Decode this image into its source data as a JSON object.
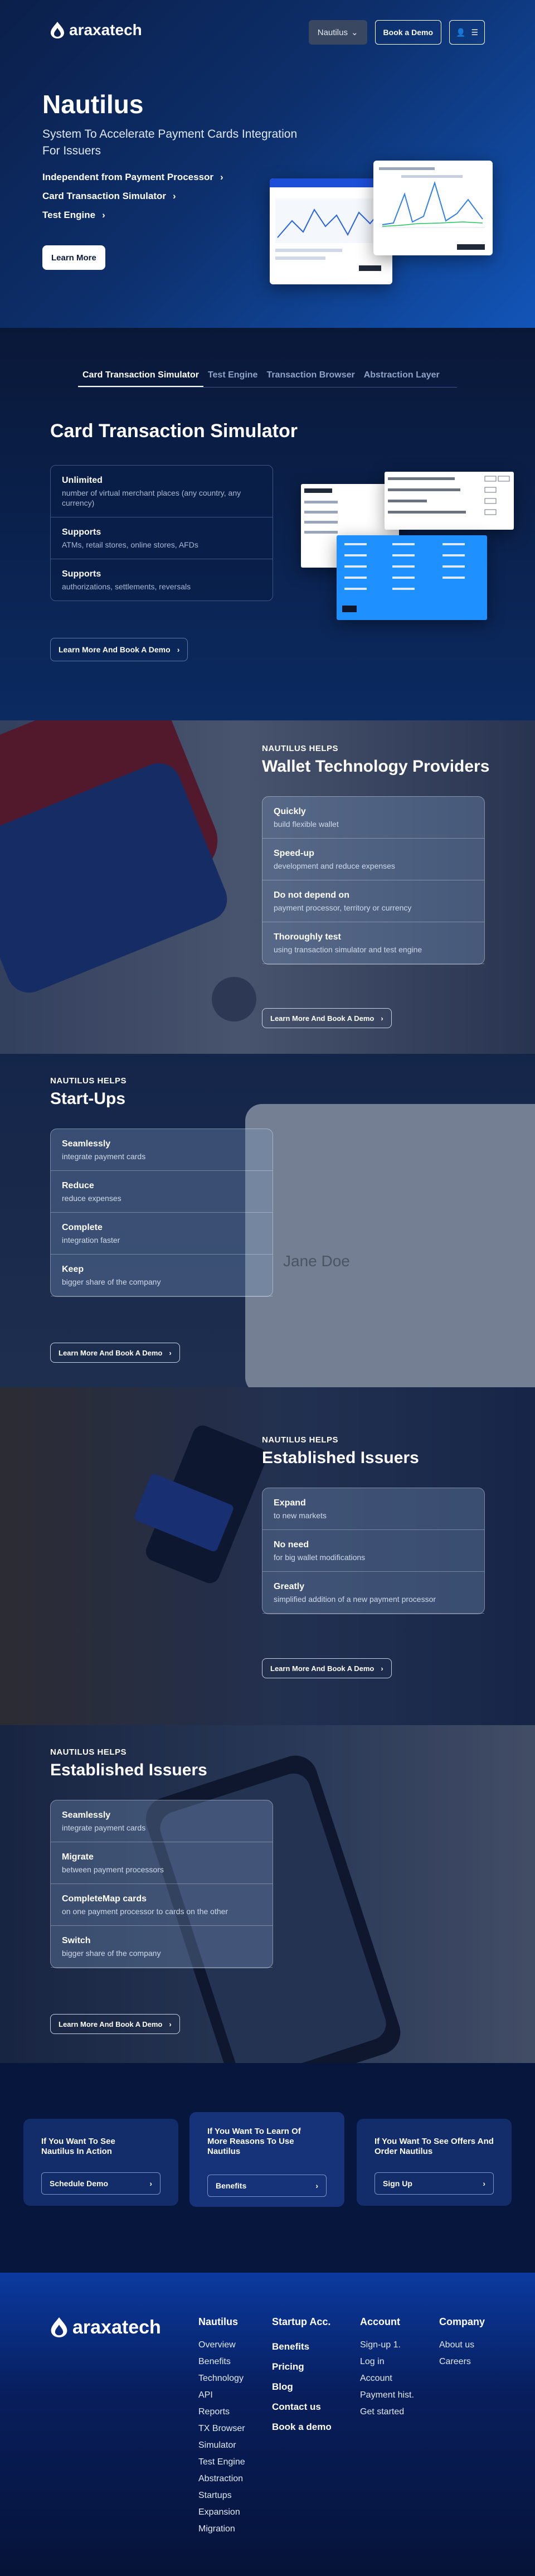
{
  "brand": {
    "name": "araxatech",
    "logo_icon": "flame-logo-icon"
  },
  "header": {
    "product_select": "Nautilus",
    "demo_button": "Book a Demo",
    "user_icon": "user-icon",
    "menu_icon": "menu-icon"
  },
  "hero": {
    "title": "Nautilus",
    "subtitle": "System To Accelerate Payment Cards Integration For Issuers",
    "links": [
      "Independent from Payment Processor",
      "Card Transaction Simulator",
      "Test Engine"
    ],
    "cta": "Learn More"
  },
  "tabs": [
    "Card Transaction Simulator",
    "Test Engine",
    "Transaction Browser",
    "Abstraction Layer"
  ],
  "simulator": {
    "title": "Card Transaction Simulator",
    "features": [
      {
        "h": "Unlimited",
        "d": "number of virtual merchant places (any country, any currency)"
      },
      {
        "h": "Supports",
        "d": "ATMs, retail stores, online stores, AFDs"
      },
      {
        "h": "Supports",
        "d": "authorizations, settlements, reversals"
      }
    ],
    "cta": "Learn More And Book A Demo"
  },
  "wallet": {
    "kicker": "NAUTILUS HELPS",
    "title": "Wallet Technology Providers",
    "features": [
      {
        "h": "Quickly",
        "d": "build flexible wallet"
      },
      {
        "h": "Speed-up",
        "d": "development and reduce expenses"
      },
      {
        "h": "Do not depend on",
        "d": "payment processor, territory or currency"
      },
      {
        "h": "Thoroughly test",
        "d": "using transaction simulator and test engine"
      }
    ],
    "cta": "Learn More And Book A Demo"
  },
  "startups": {
    "kicker": "NAUTILUS HELPS",
    "title": "Start-Ups",
    "card_name": "Jane Doe",
    "features": [
      {
        "h": "Seamlessly",
        "d": "integrate payment cards"
      },
      {
        "h": "Reduce",
        "d": "reduce expenses"
      },
      {
        "h": "Complete",
        "d": "integration faster"
      },
      {
        "h": "Keep",
        "d": "bigger share of the company"
      }
    ],
    "cta": "Learn More And Book A Demo"
  },
  "issuers1": {
    "kicker": "NAUTILUS HELPS",
    "title": "Established Issuers",
    "features": [
      {
        "h": "Expand",
        "d": "to new markets"
      },
      {
        "h": "No need",
        "d": "for big wallet modifications"
      },
      {
        "h": "Greatly",
        "d": "simplified addition of a new payment processor"
      }
    ],
    "cta": "Learn More And Book A Demo"
  },
  "issuers2": {
    "kicker": "NAUTILUS HELPS",
    "title": "Established Issuers",
    "features": [
      {
        "h": "Seamlessly",
        "d": "integrate payment cards"
      },
      {
        "h": "Migrate",
        "d": "between payment processors"
      },
      {
        "h": "CompleteMap cards",
        "d": "on one payment processor to cards on the other"
      },
      {
        "h": "Switch",
        "d": "bigger share of the company"
      }
    ],
    "cta": "Learn More And Book A Demo"
  },
  "cta_cards": [
    {
      "title": "If You Want To See Nautilus In Action",
      "button": "Schedule Demo"
    },
    {
      "title": "If You Want To Learn Of More Reasons To Use Nautilus",
      "button": "Benefits"
    },
    {
      "title": "If You Want To See Offers And Order Nautilus",
      "button": "Sign Up"
    }
  ],
  "footer": {
    "nautilus": {
      "title": "Nautilus",
      "links": [
        "Overview",
        "Benefits",
        "Technology",
        "API",
        "Reports",
        "TX Browser",
        "Simulator",
        "Test Engine",
        "Abstraction",
        "Startups",
        "Expansion",
        "Migration"
      ]
    },
    "startup": {
      "title": "Startup Acc.",
      "links": [
        "Benefits",
        "Pricing",
        "Blog",
        "Contact us",
        "Book a demo"
      ]
    },
    "account": {
      "title": "Account",
      "links": [
        "Sign-up 1.",
        "Log in",
        "Account",
        "Payment hist.",
        "Get started"
      ]
    },
    "company": {
      "title": "Company",
      "links": [
        "About us",
        "Careers"
      ]
    }
  }
}
